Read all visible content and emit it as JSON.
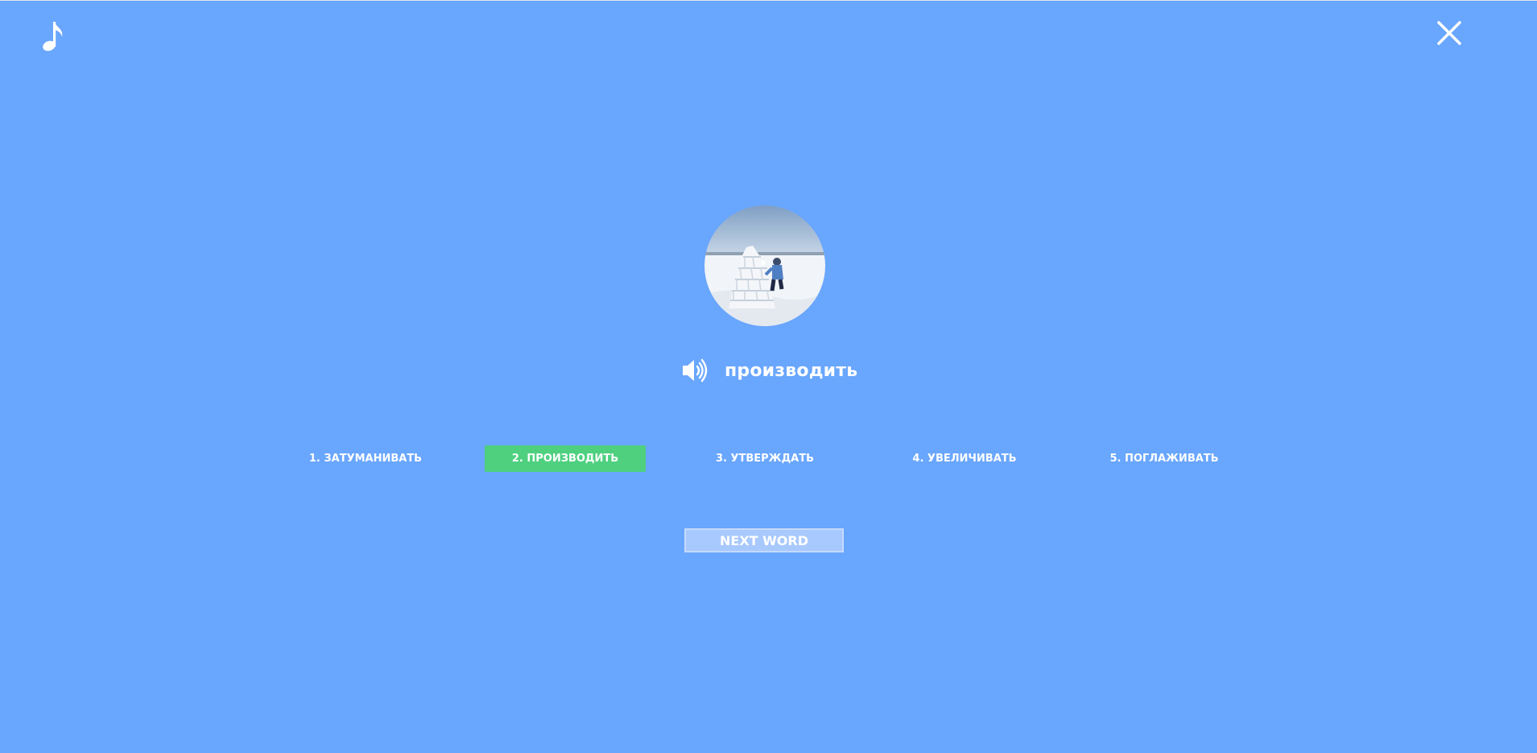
{
  "icons": {
    "music": "music-note-icon",
    "close": "close-icon",
    "speaker": "speaker-icon"
  },
  "colors": {
    "background": "#69a6fd",
    "selected_option": "#4ed07f",
    "next_button": "#a8c9fd",
    "text": "#ffffff"
  },
  "word": {
    "text": "производить"
  },
  "options": [
    {
      "label": "1. ЗАТУМАНИВАТЬ",
      "selected": false
    },
    {
      "label": "2. ПРОИЗВОДИТЬ",
      "selected": true
    },
    {
      "label": "3. УТВЕРЖДАТЬ",
      "selected": false
    },
    {
      "label": "4. УВЕЛИЧИВАТЬ",
      "selected": false
    },
    {
      "label": "5. ПОГЛАЖИВАТЬ",
      "selected": false
    }
  ],
  "next_button": {
    "label": "NEXT WORD"
  }
}
